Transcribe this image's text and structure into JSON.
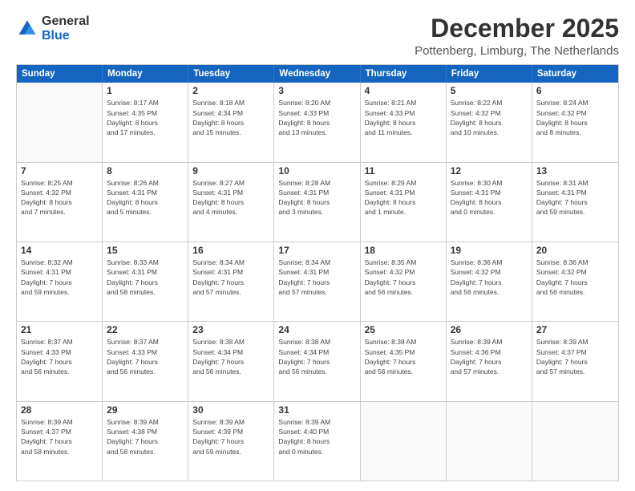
{
  "logo": {
    "general": "General",
    "blue": "Blue"
  },
  "title": "December 2025",
  "subtitle": "Pottenberg, Limburg, The Netherlands",
  "calendar": {
    "headers": [
      "Sunday",
      "Monday",
      "Tuesday",
      "Wednesday",
      "Thursday",
      "Friday",
      "Saturday"
    ],
    "weeks": [
      [
        {
          "day": "",
          "info": ""
        },
        {
          "day": "1",
          "info": "Sunrise: 8:17 AM\nSunset: 4:35 PM\nDaylight: 8 hours\nand 17 minutes."
        },
        {
          "day": "2",
          "info": "Sunrise: 8:18 AM\nSunset: 4:34 PM\nDaylight: 8 hours\nand 15 minutes."
        },
        {
          "day": "3",
          "info": "Sunrise: 8:20 AM\nSunset: 4:33 PM\nDaylight: 8 hours\nand 13 minutes."
        },
        {
          "day": "4",
          "info": "Sunrise: 8:21 AM\nSunset: 4:33 PM\nDaylight: 8 hours\nand 11 minutes."
        },
        {
          "day": "5",
          "info": "Sunrise: 8:22 AM\nSunset: 4:32 PM\nDaylight: 8 hours\nand 10 minutes."
        },
        {
          "day": "6",
          "info": "Sunrise: 8:24 AM\nSunset: 4:32 PM\nDaylight: 8 hours\nand 8 minutes."
        }
      ],
      [
        {
          "day": "7",
          "info": "Sunrise: 8:25 AM\nSunset: 4:32 PM\nDaylight: 8 hours\nand 7 minutes."
        },
        {
          "day": "8",
          "info": "Sunrise: 8:26 AM\nSunset: 4:31 PM\nDaylight: 8 hours\nand 5 minutes."
        },
        {
          "day": "9",
          "info": "Sunrise: 8:27 AM\nSunset: 4:31 PM\nDaylight: 8 hours\nand 4 minutes."
        },
        {
          "day": "10",
          "info": "Sunrise: 8:28 AM\nSunset: 4:31 PM\nDaylight: 8 hours\nand 3 minutes."
        },
        {
          "day": "11",
          "info": "Sunrise: 8:29 AM\nSunset: 4:31 PM\nDaylight: 8 hours\nand 1 minute."
        },
        {
          "day": "12",
          "info": "Sunrise: 8:30 AM\nSunset: 4:31 PM\nDaylight: 8 hours\nand 0 minutes."
        },
        {
          "day": "13",
          "info": "Sunrise: 8:31 AM\nSunset: 4:31 PM\nDaylight: 7 hours\nand 59 minutes."
        }
      ],
      [
        {
          "day": "14",
          "info": "Sunrise: 8:32 AM\nSunset: 4:31 PM\nDaylight: 7 hours\nand 59 minutes."
        },
        {
          "day": "15",
          "info": "Sunrise: 8:33 AM\nSunset: 4:31 PM\nDaylight: 7 hours\nand 58 minutes."
        },
        {
          "day": "16",
          "info": "Sunrise: 8:34 AM\nSunset: 4:31 PM\nDaylight: 7 hours\nand 57 minutes."
        },
        {
          "day": "17",
          "info": "Sunrise: 8:34 AM\nSunset: 4:31 PM\nDaylight: 7 hours\nand 57 minutes."
        },
        {
          "day": "18",
          "info": "Sunrise: 8:35 AM\nSunset: 4:32 PM\nDaylight: 7 hours\nand 56 minutes."
        },
        {
          "day": "19",
          "info": "Sunrise: 8:36 AM\nSunset: 4:32 PM\nDaylight: 7 hours\nand 56 minutes."
        },
        {
          "day": "20",
          "info": "Sunrise: 8:36 AM\nSunset: 4:32 PM\nDaylight: 7 hours\nand 56 minutes."
        }
      ],
      [
        {
          "day": "21",
          "info": "Sunrise: 8:37 AM\nSunset: 4:33 PM\nDaylight: 7 hours\nand 56 minutes."
        },
        {
          "day": "22",
          "info": "Sunrise: 8:37 AM\nSunset: 4:33 PM\nDaylight: 7 hours\nand 56 minutes."
        },
        {
          "day": "23",
          "info": "Sunrise: 8:38 AM\nSunset: 4:34 PM\nDaylight: 7 hours\nand 56 minutes."
        },
        {
          "day": "24",
          "info": "Sunrise: 8:38 AM\nSunset: 4:34 PM\nDaylight: 7 hours\nand 56 minutes."
        },
        {
          "day": "25",
          "info": "Sunrise: 8:38 AM\nSunset: 4:35 PM\nDaylight: 7 hours\nand 56 minutes."
        },
        {
          "day": "26",
          "info": "Sunrise: 8:39 AM\nSunset: 4:36 PM\nDaylight: 7 hours\nand 57 minutes."
        },
        {
          "day": "27",
          "info": "Sunrise: 8:39 AM\nSunset: 4:37 PM\nDaylight: 7 hours\nand 57 minutes."
        }
      ],
      [
        {
          "day": "28",
          "info": "Sunrise: 8:39 AM\nSunset: 4:37 PM\nDaylight: 7 hours\nand 58 minutes."
        },
        {
          "day": "29",
          "info": "Sunrise: 8:39 AM\nSunset: 4:38 PM\nDaylight: 7 hours\nand 58 minutes."
        },
        {
          "day": "30",
          "info": "Sunrise: 8:39 AM\nSunset: 4:39 PM\nDaylight: 7 hours\nand 59 minutes."
        },
        {
          "day": "31",
          "info": "Sunrise: 8:39 AM\nSunset: 4:40 PM\nDaylight: 8 hours\nand 0 minutes."
        },
        {
          "day": "",
          "info": ""
        },
        {
          "day": "",
          "info": ""
        },
        {
          "day": "",
          "info": ""
        }
      ]
    ]
  }
}
